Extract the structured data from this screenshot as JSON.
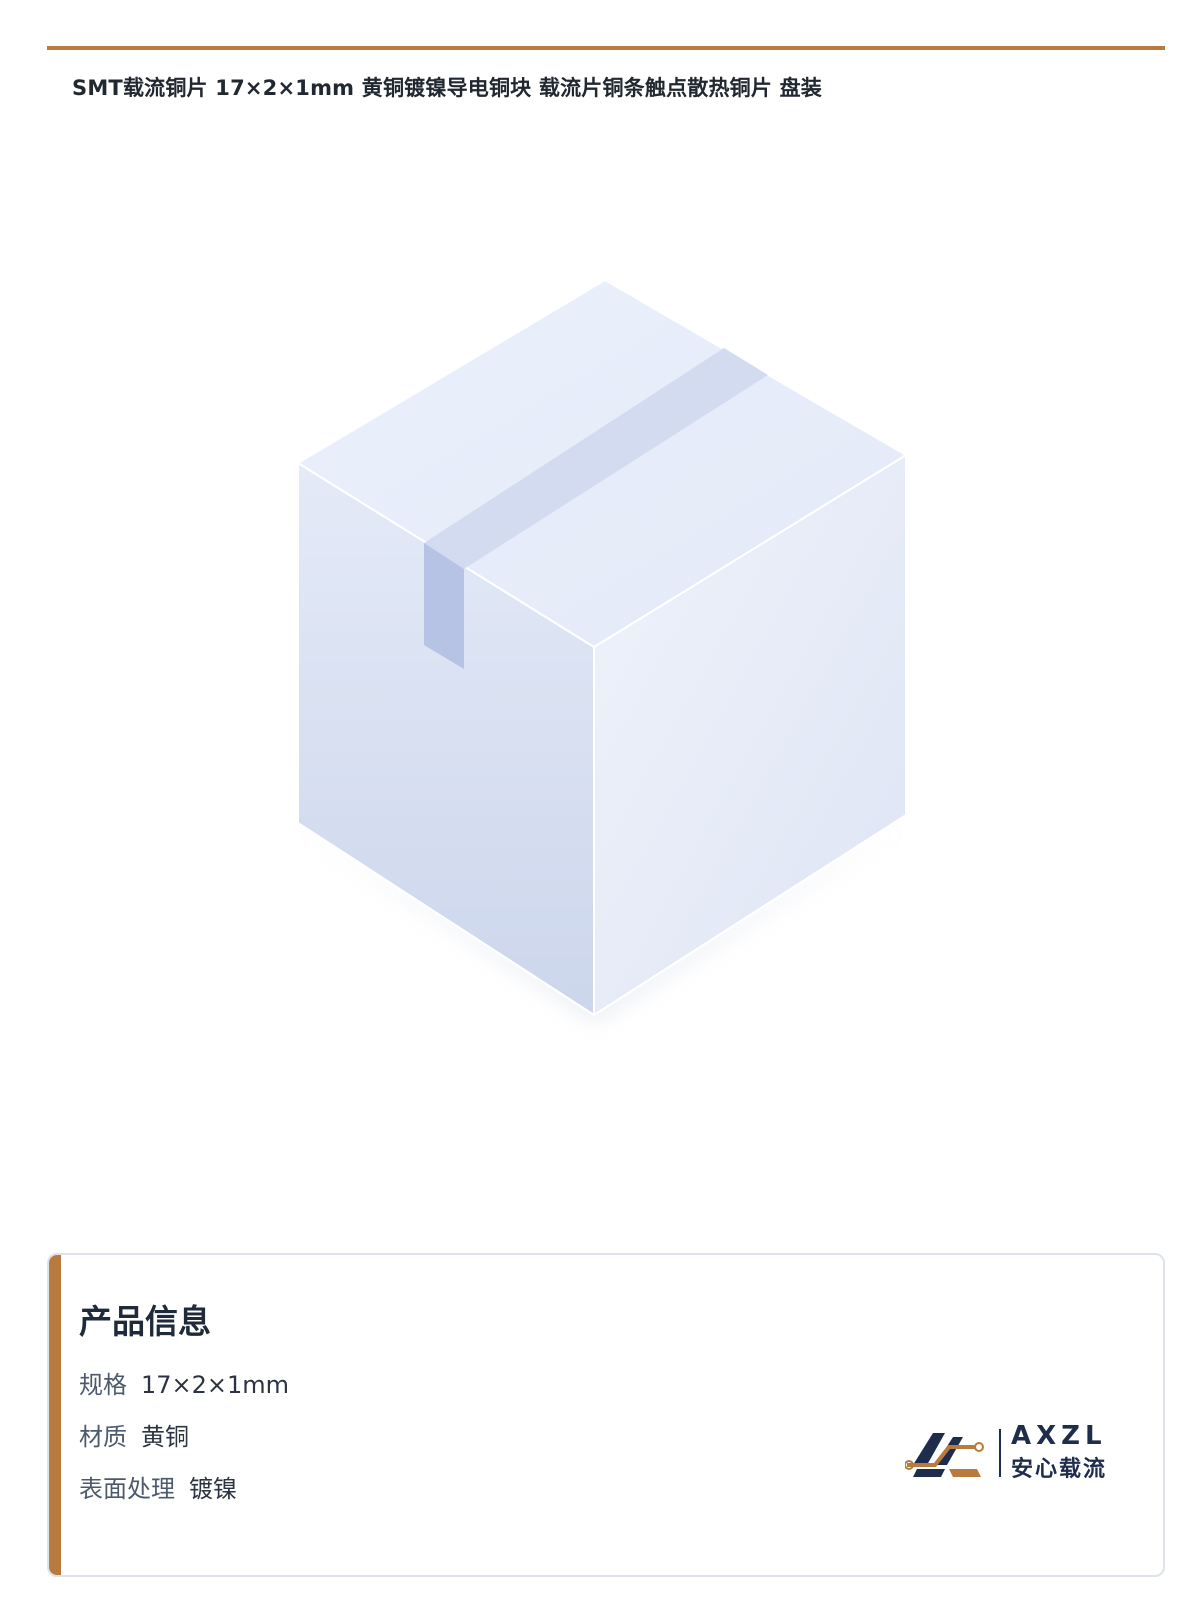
{
  "page": {
    "title": "SMT载流铜片 17×2×1mm 黄铜镀镍导电铜块 载流片铜条触点散热铜片 盘装",
    "accent_color": "#b87a3d"
  },
  "illustration": {
    "icon": "shipping-box-icon"
  },
  "info": {
    "heading": "产品信息",
    "rows": [
      {
        "label": "规格",
        "value": "17×2×1mm"
      },
      {
        "label": "材质",
        "value": "黄铜"
      },
      {
        "label": "表面处理",
        "value": "镀镍"
      }
    ]
  },
  "brand": {
    "name_en": "AXZL",
    "name_cn": "安心载流",
    "logo_icon": "axzl-logo-icon",
    "color_primary": "#1f2d4d",
    "color_secondary": "#b87a3d"
  }
}
